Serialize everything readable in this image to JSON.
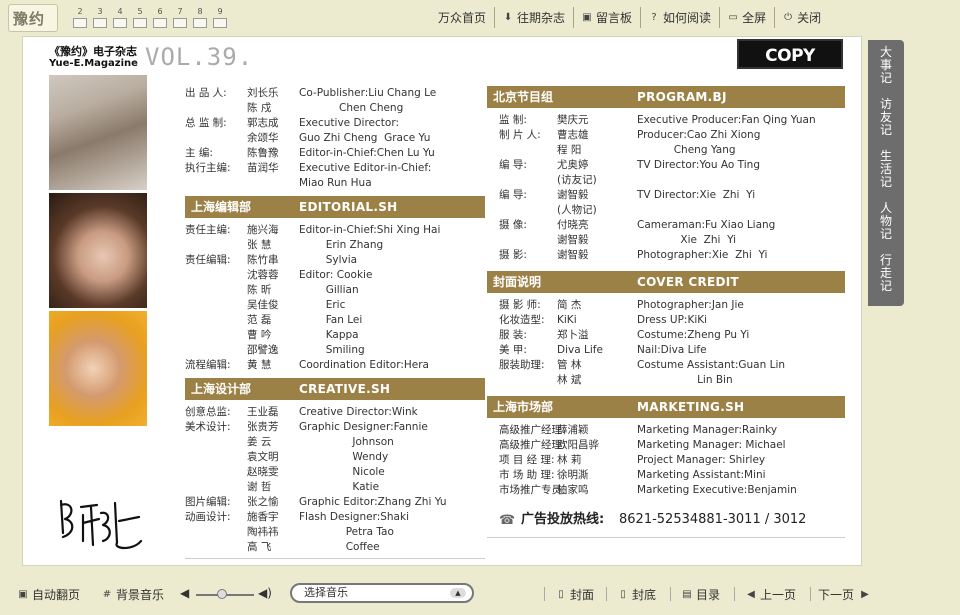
{
  "topbar": {
    "logo": "豫约",
    "page_numbers": [
      "2",
      "3",
      "4",
      "5",
      "6",
      "7",
      "8",
      "9"
    ],
    "nav": [
      {
        "icon": "",
        "label": "万众首页",
        "icon_name": "separator"
      },
      {
        "icon": "⬇",
        "label": "往期杂志",
        "icon_name": "download-icon"
      },
      {
        "icon": "▣",
        "label": "留言板",
        "icon_name": "board-icon"
      },
      {
        "icon": "?",
        "label": "如何阅读",
        "icon_name": "help-icon"
      },
      {
        "icon": "▭",
        "label": "全屏",
        "icon_name": "fullscreen-icon"
      },
      {
        "icon": "⏻",
        "label": "关闭",
        "icon_name": "power-icon"
      }
    ]
  },
  "header": {
    "mag_title": "《豫约》电子杂志",
    "mag_sub": "Yue-E.Magazine",
    "vol": "VOL.39.",
    "copyright": "COPY RIGHTS"
  },
  "col1": {
    "rows1": [
      {
        "r": "出 品 人:",
        "nm": "刘长乐",
        "en": "Co-Publisher:Liu Chang Le"
      },
      {
        "r": "",
        "nm": "陈  戍",
        "en": "            Chen Cheng"
      },
      {
        "r": "总 监 制:",
        "nm": "郭志成",
        "en": "Executive Director:"
      },
      {
        "r": "",
        "nm": "余颂华",
        "en": "Guo Zhi Cheng  Grace Yu"
      },
      {
        "r": "主   编:",
        "nm": "陈鲁豫",
        "en": "Editor-in-Chief:Chen Lu Yu"
      },
      {
        "r": "执行主编:",
        "nm": "苗润华",
        "en": "Executive Editor-in-Chief:"
      },
      {
        "r": "",
        "nm": "",
        "en": "Miao Run Hua"
      }
    ],
    "sec1": {
      "cn": "上海编辑部",
      "en": "EDITORIAL.SH"
    },
    "rows2": [
      {
        "r": "责任主编:",
        "nm": "施兴海",
        "en": "Editor-in-Chief:Shi Xing Hai"
      },
      {
        "r": "",
        "nm": "张  慧",
        "en": "        Erin Zhang"
      },
      {
        "r": "责任编辑:",
        "nm": "陈竹串",
        "en": "        Sylvia"
      },
      {
        "r": "",
        "nm": "沈蓉蓉",
        "en": "Editor: Cookie"
      },
      {
        "r": "",
        "nm": "陈  昕",
        "en": "        Gillian"
      },
      {
        "r": "",
        "nm": "吴佳俊",
        "en": "        Eric"
      },
      {
        "r": "",
        "nm": "范  磊",
        "en": "        Fan Lei"
      },
      {
        "r": "",
        "nm": "曹  吟",
        "en": "        Kappa"
      },
      {
        "r": "",
        "nm": "邵譬逸",
        "en": "        Smiling"
      },
      {
        "r": "流程编辑:",
        "nm": "黄  慧",
        "en": "Coordination Editor:Hera"
      }
    ],
    "sec2": {
      "cn": "上海设计部",
      "en": "CREATIVE.SH"
    },
    "rows3": [
      {
        "r": "创意总监:",
        "nm": "王业磊",
        "en": "Creative Director:Wink"
      },
      {
        "r": "美术设计:",
        "nm": "张贵芳",
        "en": "Graphic Designer:Fannie"
      },
      {
        "r": "",
        "nm": "姜  云",
        "en": "                Johnson"
      },
      {
        "r": "",
        "nm": "袁文明",
        "en": "                Wendy"
      },
      {
        "r": "",
        "nm": "赵晓雯",
        "en": "                Nicole"
      },
      {
        "r": "",
        "nm": "谢  哲",
        "en": "                Katie"
      },
      {
        "r": "图片编辑:",
        "nm": "张之愉",
        "en": "Graphic Editor:Zhang Zhi Yu"
      },
      {
        "r": "动画设计:",
        "nm": "施香宇",
        "en": "Flash Designer:Shaki"
      },
      {
        "r": "",
        "nm": "陶祎祎",
        "en": "              Petra Tao"
      },
      {
        "r": "",
        "nm": "高  飞",
        "en": "              Coffee"
      }
    ]
  },
  "col2": {
    "sec1": {
      "cn": "北京节目组",
      "en": "PROGRAM.BJ"
    },
    "rows1": [
      {
        "r": "监    制:",
        "nm": "樊庆元",
        "en": "Executive Producer:Fan Qing Yuan"
      },
      {
        "r": "制 片 人:",
        "nm": "曹志雄",
        "en": "Producer:Cao Zhi Xiong"
      },
      {
        "r": "",
        "nm": "程  阳",
        "en": "           Cheng Yang"
      },
      {
        "r": "编    导:",
        "nm": "尤奥婷",
        "en": "TV Director:You Ao Ting"
      },
      {
        "r": "",
        "nm": "(访友记)",
        "en": ""
      },
      {
        "r": "编    导:",
        "nm": "谢智毅",
        "en": "TV Director:Xie  Zhi  Yi"
      },
      {
        "r": "",
        "nm": "(人物记)",
        "en": ""
      },
      {
        "r": "摄    像:",
        "nm": "付晓亮",
        "en": "Cameraman:Fu Xiao Liang"
      },
      {
        "r": "",
        "nm": "谢智毅",
        "en": "             Xie  Zhi  Yi"
      },
      {
        "r": "摄    影:",
        "nm": "谢智毅",
        "en": "Photographer:Xie  Zhi  Yi"
      }
    ],
    "sec2": {
      "cn": "封面说明",
      "en": "COVER CREDIT"
    },
    "rows2": [
      {
        "r": "摄 影 师:",
        "nm": "简  杰",
        "en": "Photographer:Jan Jie"
      },
      {
        "r": "化妆造型:",
        "nm": "KiKi",
        "en": "Dress UP:KiKi"
      },
      {
        "r": "服    装:",
        "nm": "郑卜溢",
        "en": "Costume:Zheng Pu Yi"
      },
      {
        "r": "美    甲:",
        "nm": "Diva Life",
        "en": "Nail:Diva Life"
      },
      {
        "r": "服装助理:",
        "nm": "管  林",
        "en": "Costume Assistant:Guan Lin"
      },
      {
        "r": "",
        "nm": "林  斌",
        "en": "                  Lin Bin"
      }
    ],
    "sec3": {
      "cn": "上海市场部",
      "en": "MARKETING.SH"
    },
    "rows3": [
      {
        "r": "高级推广经理:",
        "nm": "薛浦颖",
        "en": "Marketing Manager:Rainky"
      },
      {
        "r": "高级推广经理:",
        "nm": "欧阳昌骅",
        "en": "Marketing Manager: Michael"
      },
      {
        "r": "项 目  经 理:",
        "nm": "林  莉",
        "en": "Project Manager: Shirley"
      },
      {
        "r": "市 场  助 理:",
        "nm": "徐明澌",
        "en": "Marketing Assistant:Mini"
      },
      {
        "r": "市场推广专员:",
        "nm": "柏家鸣",
        "en": "Marketing Executive:Benjamin"
      }
    ],
    "hotline_label": "广告投放热线:",
    "hotline_number": "8621-52534881-3011 / 3012"
  },
  "side_tabs": [
    "大事记",
    "访友记",
    "生活记",
    "人物记",
    "行走记"
  ],
  "bottombar": {
    "auto_flip": "自动翻页",
    "bg_music": "背景音乐",
    "music_select": "选择音乐",
    "volume_level": 0.45,
    "front_cover": "封面",
    "back_cover": "封底",
    "toc": "目录",
    "prev": "上一页",
    "next": "下一页"
  }
}
